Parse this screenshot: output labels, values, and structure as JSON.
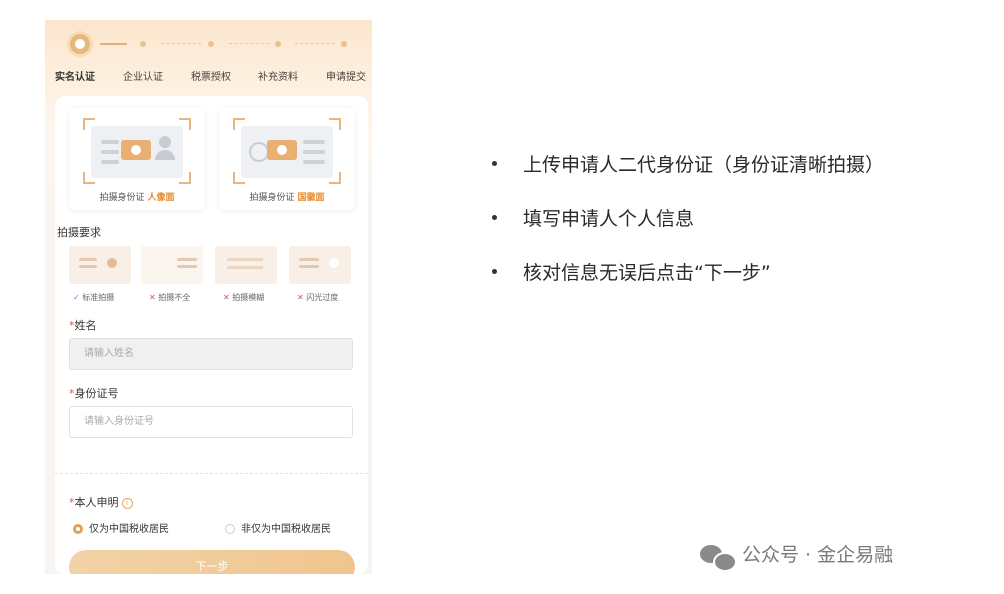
{
  "steps": [
    "实名认证",
    "企业认证",
    "税票授权",
    "补充资料",
    "申请提交"
  ],
  "id_upload": {
    "portrait": {
      "prefix": "拍摄身份证",
      "highlight": "人像面"
    },
    "emblem": {
      "prefix": "拍摄身份证",
      "highlight": "国徽面"
    }
  },
  "requirements": {
    "title": "拍摄要求",
    "items": [
      {
        "mark": "✓",
        "label": "标准拍摄"
      },
      {
        "mark": "✕",
        "label": "拍摄不全"
      },
      {
        "mark": "✕",
        "label": "拍摄模糊"
      },
      {
        "mark": "✕",
        "label": "闪光过度"
      }
    ]
  },
  "form": {
    "name_label": "姓名",
    "name_placeholder": "请输入姓名",
    "id_label": "身份证号",
    "id_placeholder": "请输入身份证号",
    "declaration_label": "本人申明",
    "info_icon": "i",
    "radio_1": "仅为中国税收居民",
    "radio_2": "非仅为中国税收居民",
    "next_button": "下一步",
    "required_mark": "*"
  },
  "bullets": [
    "上传申请人二代身份证（身份证清晰拍摄）",
    "填写申请人个人信息",
    "核对信息无误后点击“下一步”"
  ],
  "watermark": "公众号 · 金企易融",
  "colors": {
    "accent": "#e0a25a",
    "highlight": "#e68a2e",
    "error": "#e05050",
    "ok": "#4a8ad6"
  }
}
